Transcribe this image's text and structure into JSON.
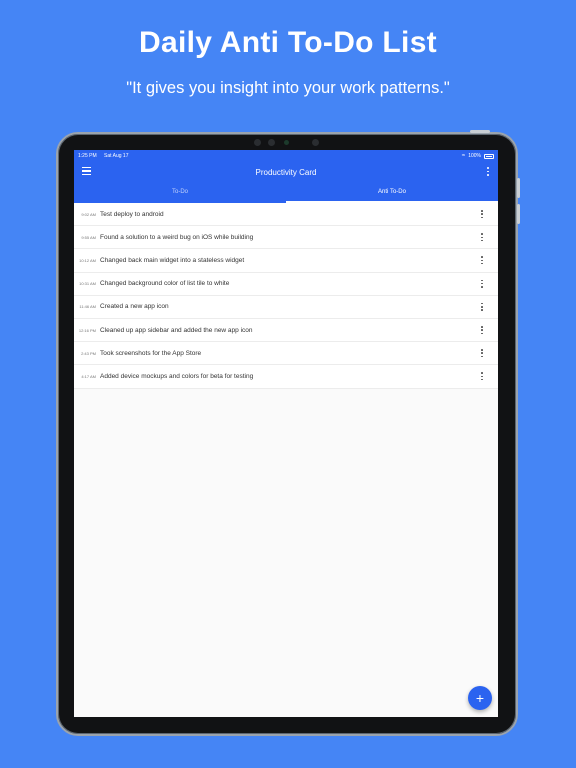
{
  "promo": {
    "headline": "Daily Anti To-Do List",
    "subline": "\"It gives you insight into your work patterns.\""
  },
  "status_bar": {
    "time": "1:25 PM",
    "date": "Sat Aug 17",
    "battery": "100%"
  },
  "app": {
    "title": "Productivity Card",
    "accent_color": "#2b63f0",
    "background_color": "#4585f5",
    "tabs": [
      {
        "label": "To-Do",
        "active": false
      },
      {
        "label": "Anti To-Do",
        "active": true
      }
    ],
    "items": [
      {
        "time": "9:02 AM",
        "text": "Test deploy to android"
      },
      {
        "time": "9:55 AM",
        "text": "Found a solution to a weird bug on iOS while building"
      },
      {
        "time": "10:12 AM",
        "text": "Changed back main widget into a stateless widget"
      },
      {
        "time": "10:31 AM",
        "text": "Changed background color of list tile to white"
      },
      {
        "time": "11:46 AM",
        "text": "Created a new app icon"
      },
      {
        "time": "12:16 PM",
        "text": "Cleaned up app sidebar and added the new app icon"
      },
      {
        "time": "2:43 PM",
        "text": "Took screenshots for the App Store"
      },
      {
        "time": "4:17 AM",
        "text": "Added device mockups and colors for beta for testing"
      }
    ],
    "fab_icon": "plus-icon",
    "fab_symbol": "+"
  }
}
